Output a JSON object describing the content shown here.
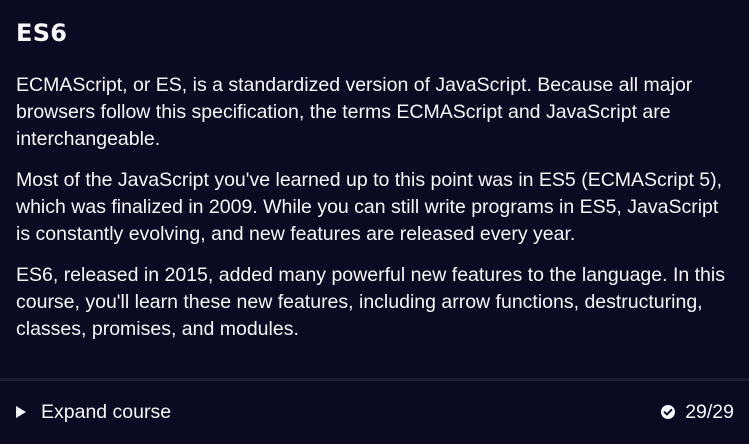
{
  "lesson": {
    "title": "ES6",
    "paragraphs": [
      "ECMAScript, or ES, is a standardized version of JavaScript. Because all major browsers follow this specification, the terms ECMAScript and JavaScript are interchangeable.",
      "Most of the JavaScript you've learned up to this point was in ES5 (ECMAScript 5), which was finalized in 2009. While you can still write programs in ES5, JavaScript is constantly evolving, and new features are released every year.",
      "ES6, released in 2015, added many powerful new features to the language. In this course, you'll learn these new features, including arrow functions, destructuring, classes, promises, and modules."
    ]
  },
  "footer": {
    "expand_label": "Expand course",
    "expand_icon": "caret-right-icon",
    "progress_icon": "check-circle-icon",
    "progress_text": "29/29",
    "progress_fraction": 1.0
  },
  "colors": {
    "background": "#0a0a23",
    "divider": "#1b1b32",
    "text": "#f5f6f7"
  }
}
